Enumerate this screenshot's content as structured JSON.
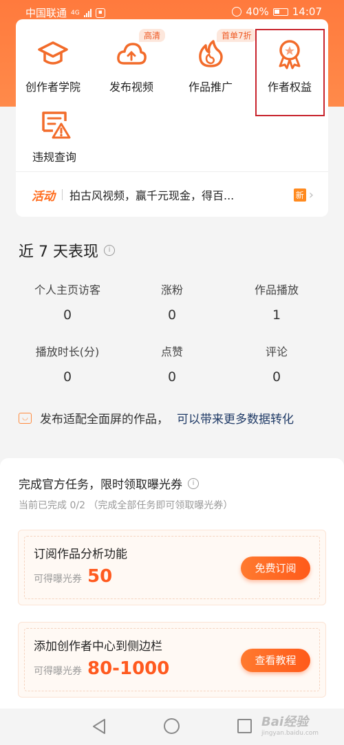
{
  "status": {
    "carrier": "中国联通",
    "net": "4G",
    "battery": "40%",
    "time": "14:07"
  },
  "tools": [
    {
      "label": "创作者学院",
      "icon": "graduation-cap-icon"
    },
    {
      "label": "发布视频",
      "icon": "cloud-upload-icon",
      "badge": "高清"
    },
    {
      "label": "作品推广",
      "icon": "fire-icon",
      "badge": "首单7折"
    },
    {
      "label": "作者权益",
      "icon": "medal-icon"
    },
    {
      "label": "违规查询",
      "icon": "violation-alert-icon"
    }
  ],
  "activity": {
    "tag": "活动",
    "text": "拍古风视频，赢千元现金，得百...",
    "badge": "新"
  },
  "performance": {
    "title": "近 7 天表现",
    "stats": [
      {
        "label": "个人主页访客",
        "value": "0"
      },
      {
        "label": "涨粉",
        "value": "0"
      },
      {
        "label": "作品播放",
        "value": "1"
      },
      {
        "label": "播放时长(分)",
        "value": "0"
      },
      {
        "label": "点赞",
        "value": "0"
      },
      {
        "label": "评论",
        "value": "0"
      }
    ],
    "tip_text": "发布适配全面屏的作品，",
    "tip_link": "可以带来更多数据转化"
  },
  "tasks": {
    "title": "完成官方任务，限时领取曝光券",
    "subtitle": "当前已完成 0/2 （完成全部任务即可领取曝光券）",
    "reward_label": "可得曝光券",
    "items": [
      {
        "name": "订阅作品分析功能",
        "reward": "50",
        "button": "免费订阅"
      },
      {
        "name": "添加创作者中心到侧边栏",
        "reward": "80-1000",
        "button": "查看教程"
      }
    ]
  },
  "watermark": {
    "text": "Bai经验",
    "url": "jingyan.baidu.com"
  },
  "colors": {
    "accent": "#ff6a1a",
    "highlight_box": "#c8232c"
  }
}
